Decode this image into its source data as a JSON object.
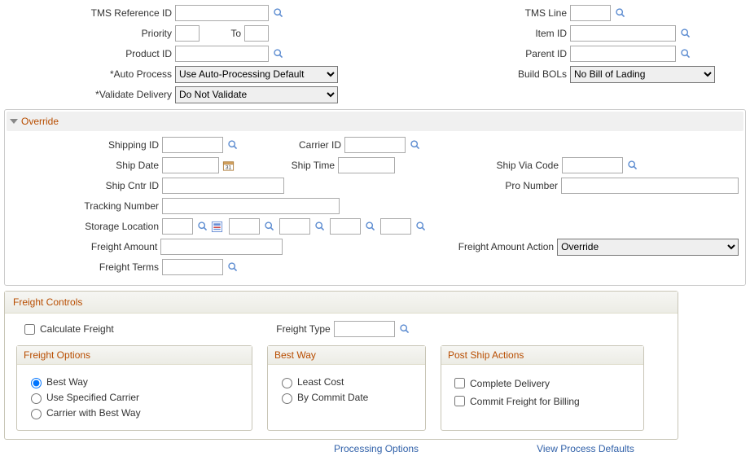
{
  "top": {
    "tms_ref_id_label": "TMS Reference ID",
    "priority_label": "Priority",
    "to_label": "To",
    "product_id_label": "Product ID",
    "auto_process_label": "*Auto Process",
    "auto_process_value": "Use Auto-Processing Default",
    "validate_delivery_label": "*Validate Delivery",
    "validate_delivery_value": "Do Not Validate",
    "tms_line_label": "TMS Line",
    "item_id_label": "Item ID",
    "parent_id_label": "Parent ID",
    "build_bols_label": "Build BOLs",
    "build_bols_value": "No Bill of Lading"
  },
  "override": {
    "title": "Override",
    "shipping_id_label": "Shipping ID",
    "ship_date_label": "Ship Date",
    "ship_cntr_id_label": "Ship Cntr ID",
    "tracking_number_label": "Tracking Number",
    "storage_location_label": "Storage Location",
    "freight_amount_label": "Freight Amount",
    "freight_terms_label": "Freight Terms",
    "carrier_id_label": "Carrier ID",
    "ship_time_label": "Ship Time",
    "ship_via_code_label": "Ship Via Code",
    "pro_number_label": "Pro Number",
    "freight_amount_action_label": "Freight Amount Action",
    "freight_amount_action_value": "Override"
  },
  "freight": {
    "title": "Freight Controls",
    "calculate_label": "Calculate Freight",
    "freight_type_label": "Freight Type",
    "options": {
      "title": "Freight Options",
      "best_way": "Best Way",
      "use_specified": "Use Specified Carrier",
      "carrier_best_way": "Carrier with Best Way"
    },
    "best_way": {
      "title": "Best Way",
      "least_cost": "Least Cost",
      "by_commit": "By Commit Date"
    },
    "post_ship": {
      "title": "Post Ship Actions",
      "complete_delivery": "Complete Delivery",
      "commit_freight": "Commit Freight for Billing"
    }
  },
  "links": {
    "processing_options": "Processing Options",
    "view_defaults": "View Process Defaults"
  }
}
